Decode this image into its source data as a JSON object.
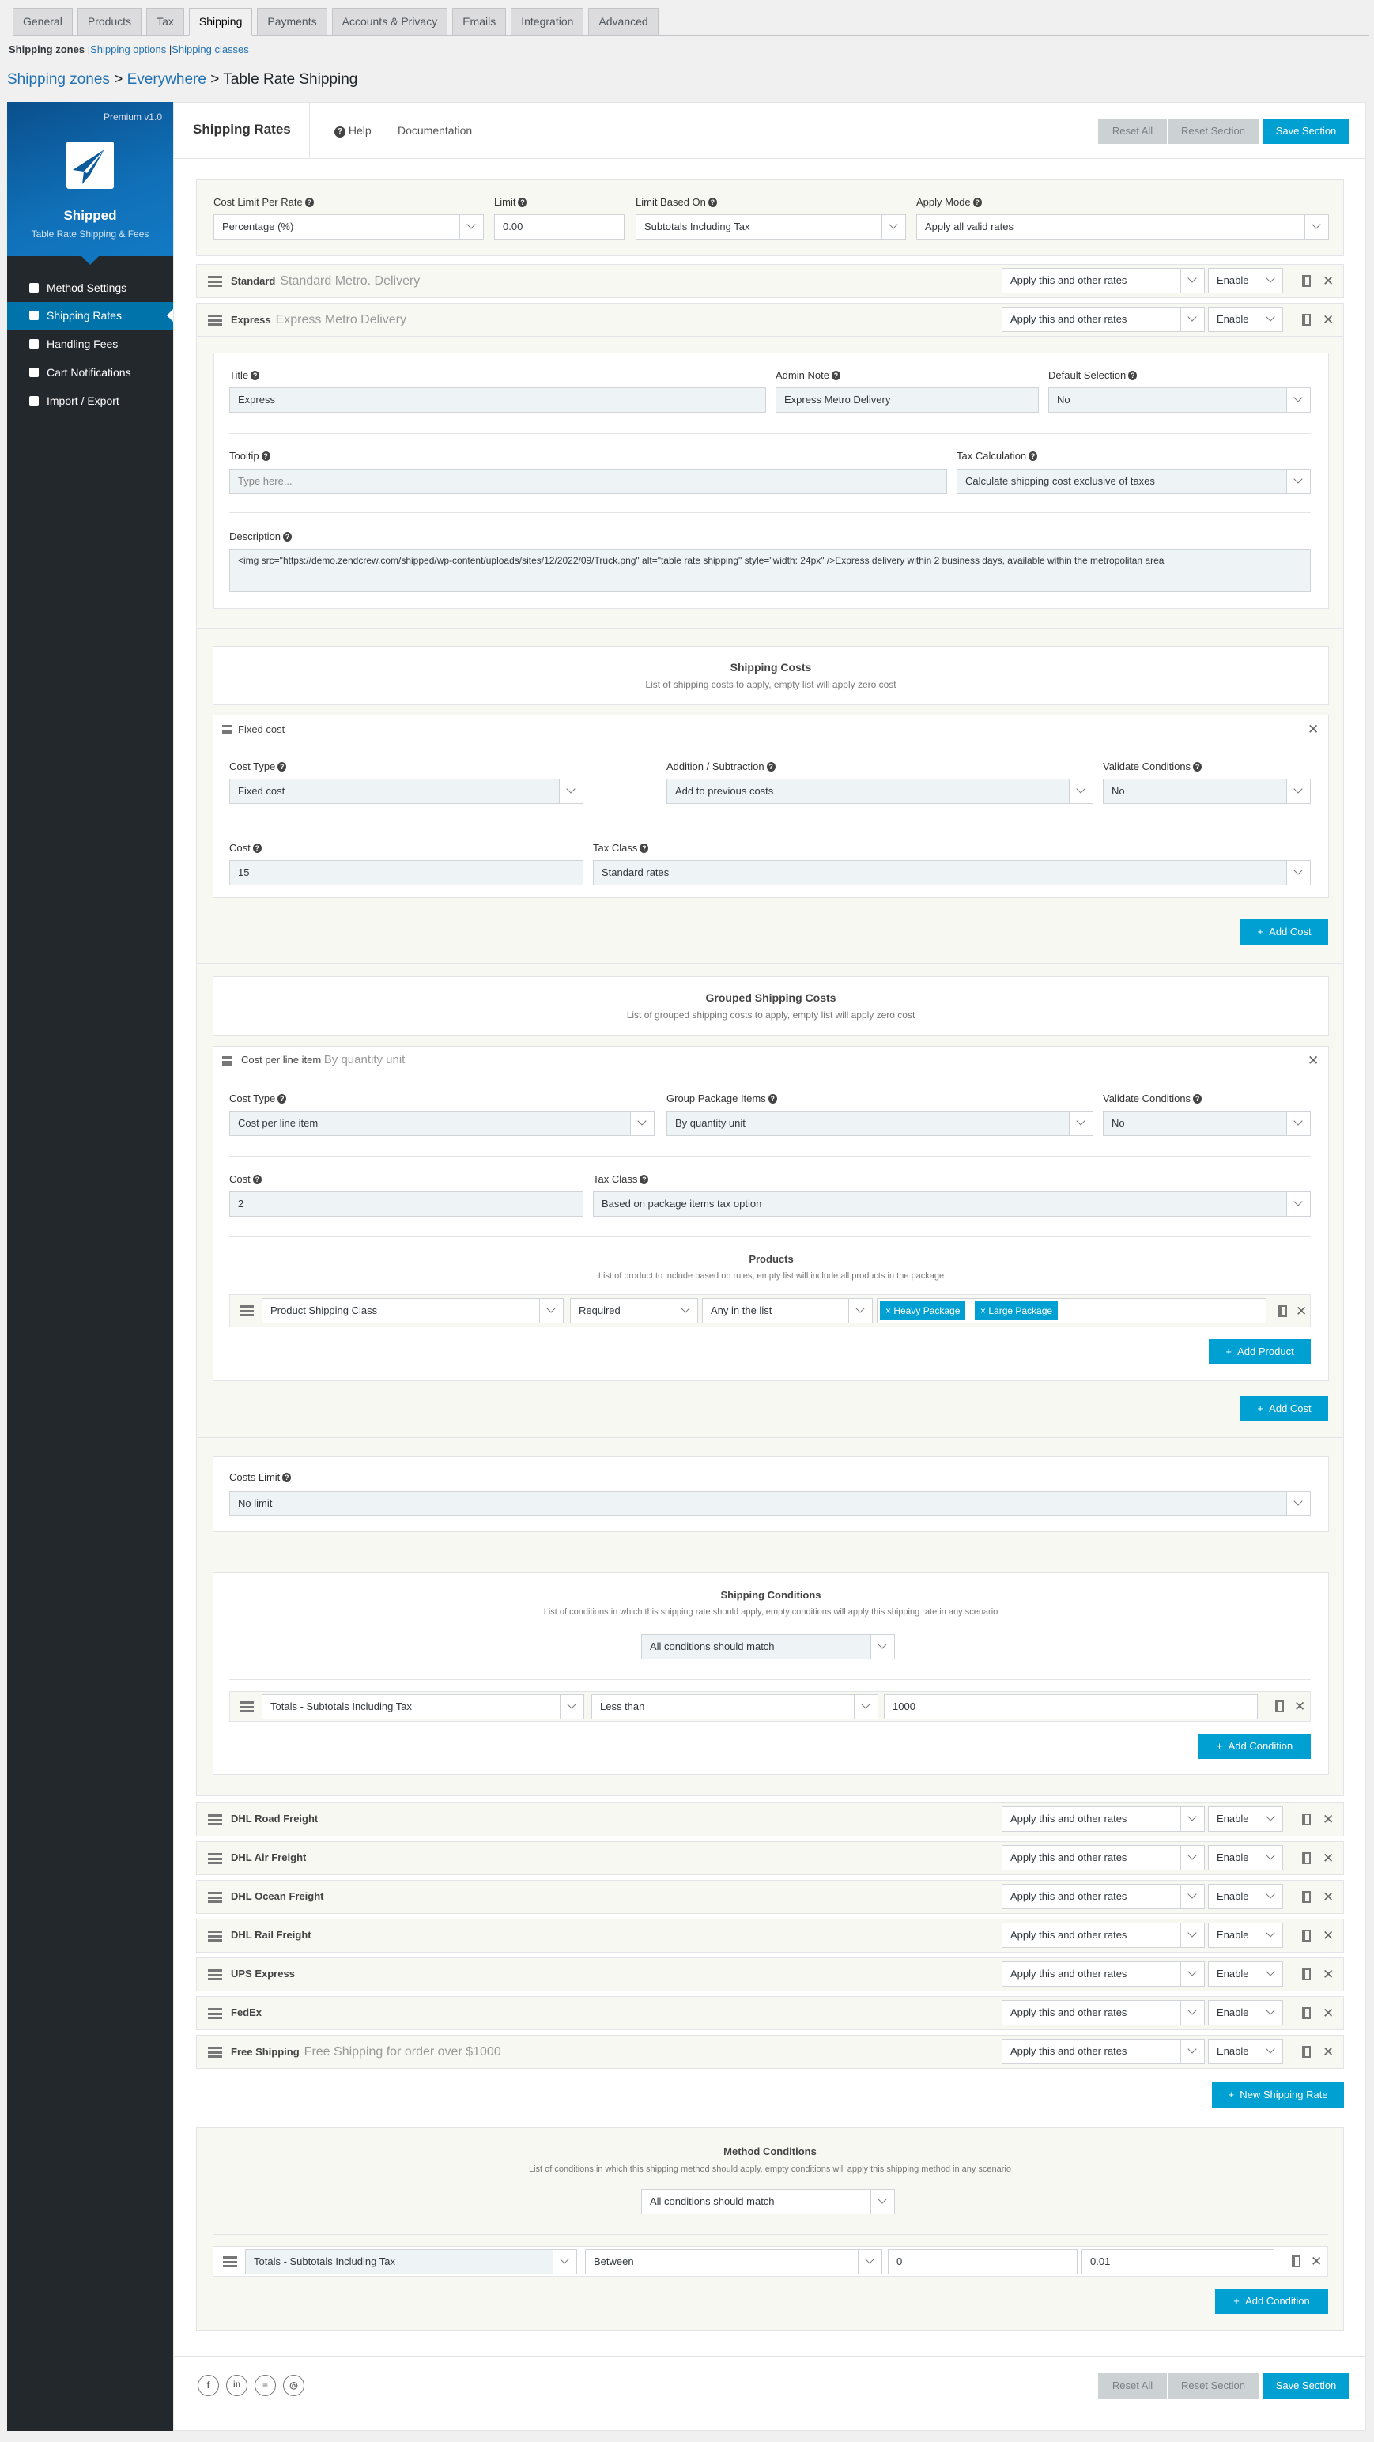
{
  "tabs": [
    "General",
    "Products",
    "Tax",
    "Shipping",
    "Payments",
    "Accounts & Privacy",
    "Emails",
    "Integration",
    "Advanced"
  ],
  "active_tab": "Shipping",
  "subnav": {
    "current": "Shipping zones",
    "sep": "|",
    "links": [
      "Shipping options",
      "Shipping classes"
    ]
  },
  "breadcrumb": {
    "zones": "Shipping zones",
    "everywhere": "Everywhere",
    "sep": ">",
    "current": "Table Rate Shipping"
  },
  "sidebar": {
    "version": "Premium v1.0",
    "name": "Shipped",
    "tagline": "Table Rate Shipping & Fees",
    "items": [
      {
        "label": "Method Settings",
        "icon": "gear-icon"
      },
      {
        "label": "Shipping Rates",
        "icon": "truck-icon",
        "active": true
      },
      {
        "label": "Handling Fees",
        "icon": "hand-box-icon"
      },
      {
        "label": "Cart Notifications",
        "icon": "notification-icon"
      },
      {
        "label": "Import / Export",
        "icon": "file-icon"
      }
    ]
  },
  "header": {
    "title": "Shipping Rates",
    "help": "Help",
    "documentation": "Documentation",
    "reset_all": "Reset All",
    "reset_section": "Reset Section",
    "save_section": "Save Section"
  },
  "general": {
    "cost_limit_label": "Cost Limit Per Rate",
    "cost_limit": "Percentage (%)",
    "limit_label": "Limit",
    "limit": "0.00",
    "limit_based_label": "Limit Based On",
    "limit_based": "Subtotals Including Tax",
    "apply_mode_label": "Apply Mode",
    "apply_mode": "Apply all valid rates"
  },
  "rates": [
    {
      "name": "Standard",
      "note": "Standard Metro. Delivery",
      "apply": "Apply this and other rates",
      "status": "Enable"
    },
    {
      "name": "Express",
      "note": "Express Metro Delivery",
      "apply": "Apply this and other rates",
      "status": "Enable"
    },
    {
      "name": "DHL Road Freight",
      "note": "",
      "apply": "Apply this and other rates",
      "status": "Enable"
    },
    {
      "name": "DHL Air Freight",
      "note": "",
      "apply": "Apply this and other rates",
      "status": "Enable"
    },
    {
      "name": "DHL Ocean Freight",
      "note": "",
      "apply": "Apply this and other rates",
      "status": "Enable"
    },
    {
      "name": "DHL Rail Freight",
      "note": "",
      "apply": "Apply this and other rates",
      "status": "Enable"
    },
    {
      "name": "UPS Express",
      "note": "",
      "apply": "Apply this and other rates",
      "status": "Enable"
    },
    {
      "name": "FedEx",
      "note": "",
      "apply": "Apply this and other rates",
      "status": "Enable"
    },
    {
      "name": "Free Shipping",
      "note": "Free Shipping for order over $1000",
      "apply": "Apply this and other rates",
      "status": "Enable"
    }
  ],
  "express": {
    "title_label": "Title",
    "title": "Express",
    "admin_note_label": "Admin Note",
    "admin_note": "Express Metro Delivery",
    "default_label": "Default Selection",
    "default": "No",
    "tooltip_label": "Tooltip",
    "tooltip_placeholder": "Type here...",
    "tax_label": "Tax Calculation",
    "tax": "Calculate shipping cost exclusive of taxes",
    "description_label": "Description",
    "description": "<img src=\"https://demo.zendcrew.com/shipped/wp-content/uploads/sites/12/2022/09/Truck.png\" alt=\"table rate shipping\" style=\"width: 24px\" />Express delivery within 2 business days, available within the metropolitan area"
  },
  "shipping_costs": {
    "title": "Shipping Costs",
    "subtitle": "List of shipping costs to apply, empty list will apply zero cost",
    "item": {
      "name": "Fixed cost",
      "cost_type_label": "Cost Type",
      "cost_type": "Fixed cost",
      "addsub_label": "Addition / Subtraction",
      "addsub": "Add to previous costs",
      "validate_label": "Validate Conditions",
      "validate": "No",
      "cost_label": "Cost",
      "cost": "15",
      "tax_class_label": "Tax Class",
      "tax_class": "Standard rates"
    },
    "add": "Add Cost"
  },
  "grouped_costs": {
    "title": "Grouped Shipping Costs",
    "subtitle": "List of grouped shipping costs to apply, empty list will apply zero cost",
    "item": {
      "name": "Cost per line item",
      "note": "By quantity unit",
      "cost_type_label": "Cost Type",
      "cost_type": "Cost per line item",
      "group_label": "Group Package Items",
      "group": "By quantity unit",
      "validate_label": "Validate Conditions",
      "validate": "No",
      "cost_label": "Cost",
      "cost": "2",
      "tax_class_label": "Tax Class",
      "tax_class": "Based on package items tax option"
    },
    "products": {
      "title": "Products",
      "subtitle": "List of product to include based on rules, empty list will include all products in the package",
      "rule": "Product Shipping Class",
      "required": "Required",
      "match": "Any in the list",
      "tags": [
        "Heavy Package",
        "Large Package"
      ],
      "add": "Add Product"
    },
    "add": "Add Cost"
  },
  "costs_limit": {
    "label": "Costs Limit",
    "value": "No limit"
  },
  "shipping_conditions": {
    "title": "Shipping Conditions",
    "subtitle": "List of conditions in which this shipping rate should apply, empty conditions will apply this shipping rate in any scenario",
    "match": "All conditions should match",
    "field": "Totals - Subtotals Including Tax",
    "op": "Less than",
    "value": "1000",
    "add": "Add Condition"
  },
  "new_rate": "New Shipping Rate",
  "method_conditions": {
    "title": "Method Conditions",
    "subtitle": "List of conditions in which this shipping method should apply, empty conditions will apply this shipping method in any scenario",
    "match": "All conditions should match",
    "field": "Totals - Subtotals Including Tax",
    "op": "Between",
    "min": "0",
    "max": "0.01",
    "add": "Add Condition"
  },
  "social": [
    "facebook-icon",
    "linkedin-icon",
    "stackoverflow-icon",
    "instagram-icon"
  ],
  "colors": {
    "accent": "#00a0d2",
    "sidebar": "#23282d",
    "active_menu": "#0073aa",
    "cream": "#f8f8f3"
  }
}
